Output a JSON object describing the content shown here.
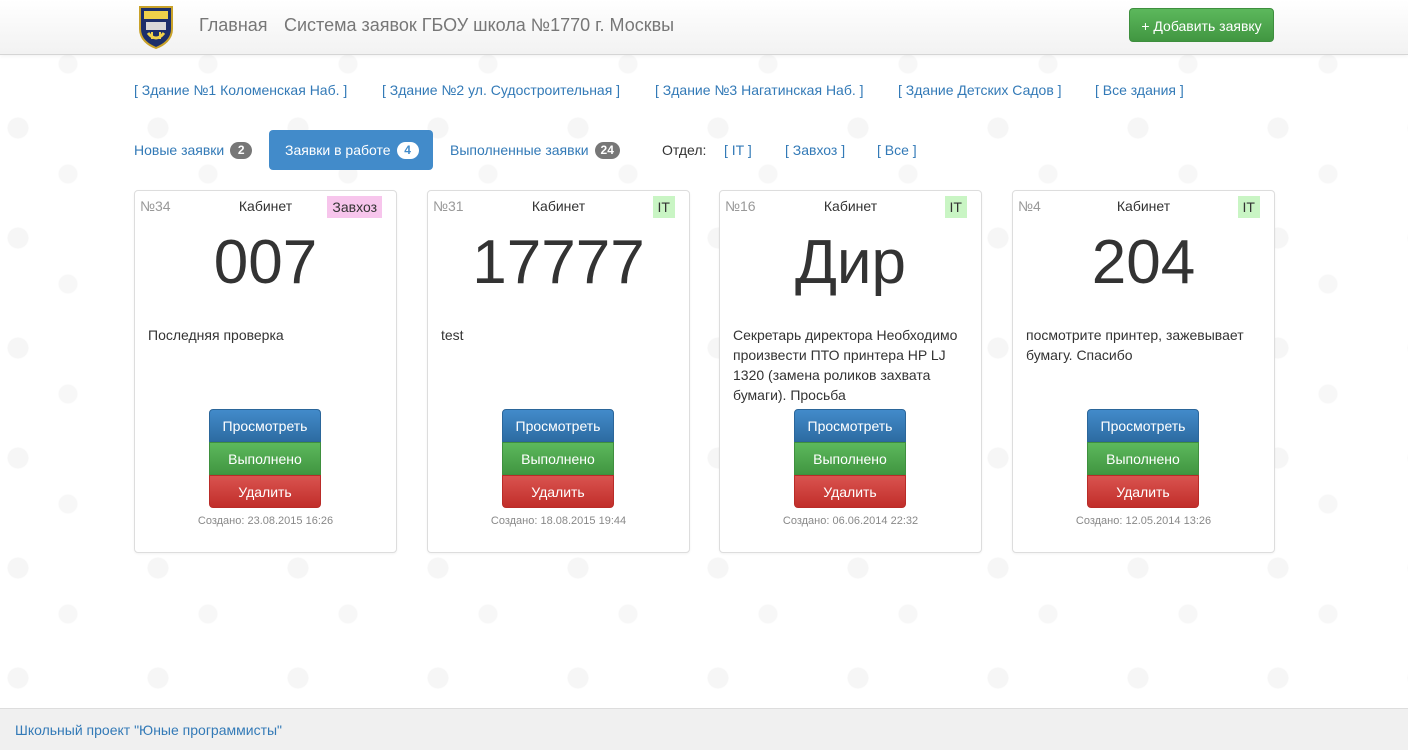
{
  "navbar": {
    "brand": "Главная",
    "system_name": "Система заявок ГБОУ школа №1770 г. Москвы",
    "add_button": "+ Добавить заявку"
  },
  "buildings": [
    "[ Здание №1 Коломенская Наб. ]",
    "[ Здание №2 ул. Судостроительная ]",
    "[ Здание №3 Нагатинская Наб. ]",
    "[ Здание Детских Садов ]",
    "[ Все здания ]"
  ],
  "tabs": [
    {
      "label": "Новые заявки",
      "count": "2"
    },
    {
      "label": "Заявки в работе",
      "count": "4"
    },
    {
      "label": "Выполненные заявки",
      "count": "24"
    }
  ],
  "departments": {
    "label": "Отдел:",
    "items": [
      "[ IT ]",
      "[ Завхоз ]",
      "[ Все ]"
    ]
  },
  "cards": [
    {
      "number": "№34",
      "room_label": "Кабинет",
      "tag": "Завхоз",
      "room": "007",
      "description": "Последняя проверка",
      "view": "Просмотреть",
      "done": "Выполнено",
      "delete": "Удалить",
      "created": "Создано: 23.08.2015 16:26"
    },
    {
      "number": "№31",
      "room_label": "Кабинет",
      "tag": "IT",
      "room": "17777",
      "description": "test",
      "view": "Просмотреть",
      "done": "Выполнено",
      "delete": "Удалить",
      "created": "Создано: 18.08.2015 19:44"
    },
    {
      "number": "№16",
      "room_label": "Кабинет",
      "tag": "IT",
      "room": "Дир",
      "description": "Секретарь директора Необходимо произвести ПТО принтера HP LJ 1320 (замена роликов захвата бумаги). Просьба",
      "view": "Просмотреть",
      "done": "Выполнено",
      "delete": "Удалить",
      "created": "Создано: 06.06.2014 22:32"
    },
    {
      "number": "№4",
      "room_label": "Кабинет",
      "tag": "IT",
      "room": "204",
      "description": "посмотрите принтер, зажевывает бумагу. Спасибо",
      "view": "Просмотреть",
      "done": "Выполнено",
      "delete": "Удалить",
      "created": "Создано: 12.05.2014 13:26"
    }
  ],
  "footer": {
    "text": "Школьный проект \"Юные программисты\""
  },
  "colors": {
    "primary": "#428bca",
    "success": "#5cb85c",
    "danger": "#d9534f",
    "tag_zavhoz": "#f7c5ec",
    "tag_it": "#c9f5c4",
    "link": "#337ab7"
  },
  "icons": {
    "logo": "school-crest-icon"
  }
}
